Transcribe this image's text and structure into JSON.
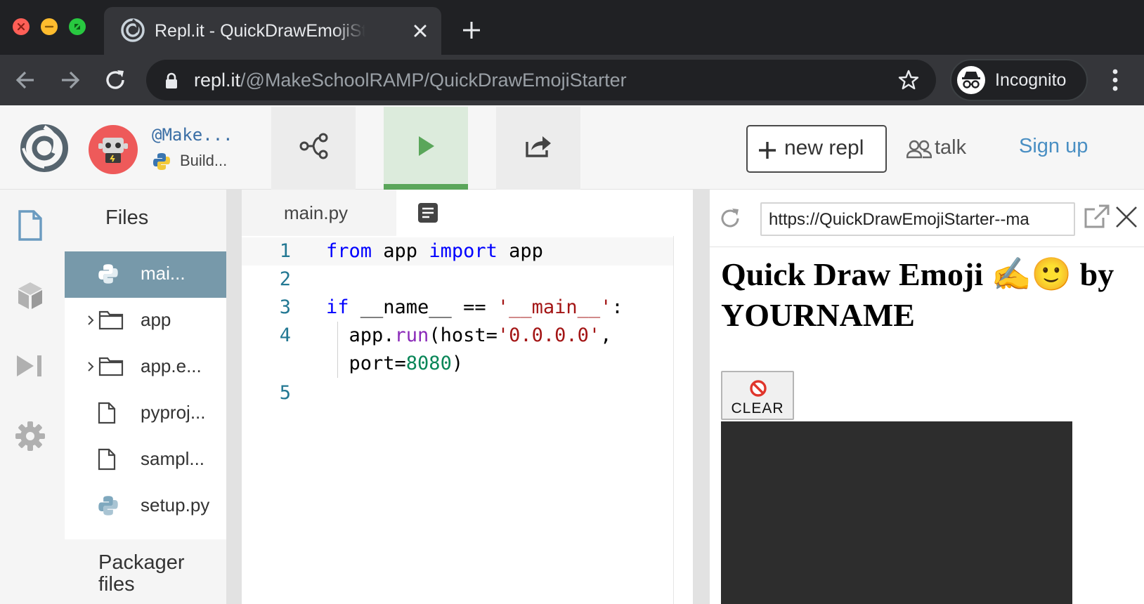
{
  "browser": {
    "tab_title": "Repl.it - QuickDrawEmojiStarter",
    "url_host": "repl.it",
    "url_path": "/@MakeSchoolRAMP/QuickDrawEmojiStarter",
    "incognito_label": "Incognito"
  },
  "header": {
    "owner": "@Make...",
    "description": "Build...",
    "new_repl_label": "new repl",
    "talk_label": "talk",
    "signup_label": "Sign up"
  },
  "files": {
    "title": "Files",
    "items": [
      {
        "label": "mai...",
        "type": "python",
        "selected": true
      },
      {
        "label": "app",
        "type": "folder"
      },
      {
        "label": "app.e...",
        "type": "folder"
      },
      {
        "label": "pyproj...",
        "type": "file"
      },
      {
        "label": "sampl...",
        "type": "file"
      },
      {
        "label": "setup.py",
        "type": "python"
      }
    ],
    "packager_title": "Packager files"
  },
  "editor": {
    "tab_label": "main.py",
    "line_numbers": [
      "1",
      "2",
      "3",
      "4",
      "5"
    ],
    "code_lines": [
      "from app import app",
      "",
      "if __name__ == '__main__':",
      "  app.run(host='0.0.0.0',",
      "  port=8080)"
    ]
  },
  "output": {
    "url": "https://QuickDrawEmojiStarter--ma",
    "heading": "Quick Draw Emoji ✍️🙂 by YOURNAME",
    "clear_label": "CLEAR"
  },
  "colors": {
    "run_green": "#5aa65a",
    "selected_file": "#7799aa",
    "signup_blue": "#4a8fc3",
    "canvas": "#2d2d2d"
  },
  "icons": [
    "close-icon",
    "minimize-icon",
    "maximize-icon",
    "replit-logo-icon",
    "plus-icon",
    "back-arrow-icon",
    "forward-arrow-icon",
    "reload-icon",
    "lock-icon",
    "star-icon",
    "incognito-icon",
    "kebab-menu-icon",
    "fork-icon",
    "play-icon",
    "share-icon",
    "talk-icon",
    "file-icon",
    "package-icon",
    "debugger-icon",
    "gear-icon",
    "python-icon",
    "folder-icon",
    "chevron-right-icon",
    "format-icon",
    "open-external-icon",
    "prohibited-icon"
  ]
}
